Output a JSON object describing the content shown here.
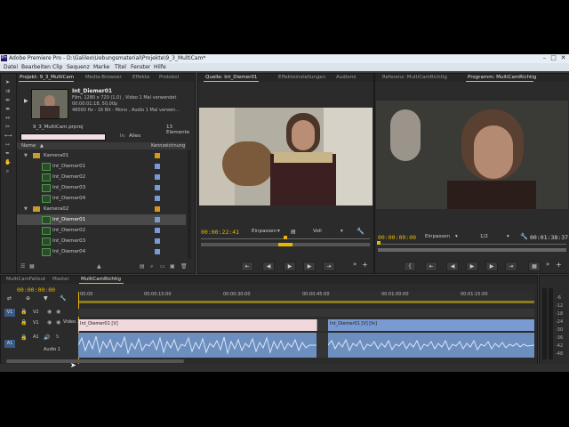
{
  "colors": {
    "accent": "#e8b800",
    "video_clip": "#f0d8dc",
    "audio_clip": "#6d8fc0",
    "video_clip_b": "#7a9ad2"
  },
  "app": {
    "title": "Adobe Premiere Pro - D:\\Galileo\\Uebungsmaterial\\Projekte\\9_3_MultiCam*",
    "icon": "Pr"
  },
  "menu": [
    "Datei",
    "Bearbeiten",
    "Clip",
    "Sequenz",
    "Marke",
    "Titel",
    "Fenster",
    "Hilfe"
  ],
  "project": {
    "tabs": [
      "Projekt: 9_3_MultiCam",
      "Media-Browser",
      "Effekte",
      "Protokol"
    ],
    "clip_name": "Int_Diemer01",
    "clip_info": [
      "Film, 1280 x 720 (1,0)  , Video 1 Mal verwendet",
      "00:00:01:18, 50,00p",
      "48000 Hz - 16 Bit - Mono , Audio 1 Mal verwen..."
    ],
    "project_file": "9_3_MultiCam.prproj",
    "search_label": "In:",
    "search_scope": "Alles",
    "elements": "13 Elemente",
    "col_name": "Name",
    "col_label": "Kennzeichnung",
    "items": [
      {
        "name": "Kamera01",
        "kind": "folder"
      },
      {
        "name": "Int_Diemer01",
        "kind": "clip"
      },
      {
        "name": "Int_Diemer02",
        "kind": "clip"
      },
      {
        "name": "Int_Diemer03",
        "kind": "clip"
      },
      {
        "name": "Int_Diemer04",
        "kind": "clip"
      },
      {
        "name": "Kamera02",
        "kind": "folder"
      },
      {
        "name": "Int_Diemer01",
        "kind": "clip",
        "selected": true
      },
      {
        "name": "Int_Diemer02",
        "kind": "clip"
      },
      {
        "name": "Int_Diemer03",
        "kind": "clip"
      },
      {
        "name": "Int_Diemer04",
        "kind": "clip"
      }
    ]
  },
  "source": {
    "tabs": [
      "Quelle: Int_Diemer01",
      "Effekteinstellungen",
      "Audiomi"
    ],
    "timecode": "00:00:22:41",
    "fit": "Einpassen",
    "quality": "Voll"
  },
  "program": {
    "tabs": [
      "Referenz: MultiCamRichtig",
      "Programm: MultiCamRichtig"
    ],
    "timecode": "00:00:00:00",
    "fit": "Einpassen",
    "quality": "1/2",
    "duration": "00:01:38:37"
  },
  "timeline": {
    "tabs": [
      "MultiCamFallout",
      "Master",
      "MultiCamRichtig"
    ],
    "timecode": "00:00:00:00",
    "ruler": [
      "00:00",
      "00:00:15:00",
      "00:00:30:00",
      "00:00:45:00",
      "00:01:00:00",
      "00:01:15:00"
    ],
    "tracks": {
      "v2": "V2",
      "v1_src": "V1",
      "v1": "Video 1",
      "a1_src": "A1",
      "a1": "Audio 1"
    },
    "clips": {
      "video_a": "Int_Diemer01 [V]",
      "video_b": "Int_Diemer01 [V] [fx]"
    },
    "audio_numbers": [
      "-6",
      "-12",
      "-18",
      "-24",
      "-30",
      "-36",
      "-42",
      "-48",
      "-54"
    ]
  }
}
